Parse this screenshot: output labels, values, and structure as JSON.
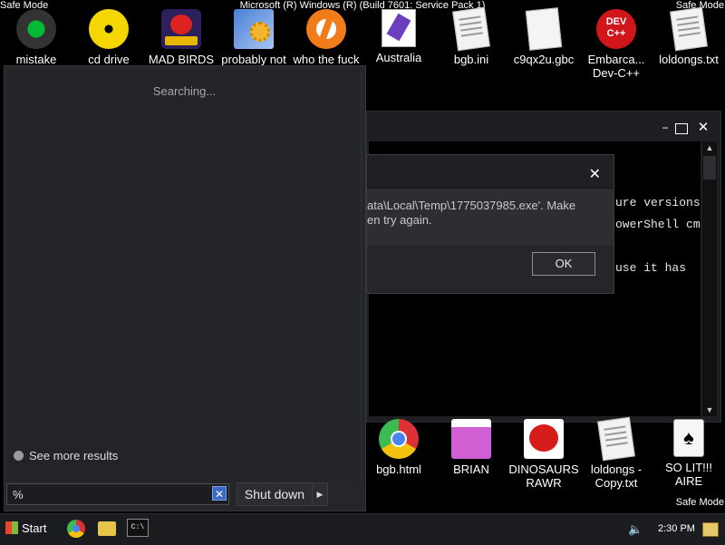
{
  "os_banner": {
    "safe_mode_left": "Safe Mode",
    "safe_mode_right": "Safe Mode",
    "safe_mode_bottom": "Safe Mode",
    "build": "Microsoft (R) Windows (R) (Build 7601: Service Pack 1)"
  },
  "desktop_icons_top": [
    {
      "label": "mistake",
      "icon": "green-disc-icon"
    },
    {
      "label": "cd drive",
      "icon": "cd-drive-icon"
    },
    {
      "label": "MAD BIRDS",
      "icon": "angry-birds-space-icon"
    },
    {
      "label": "probably not",
      "icon": "control-panel-icon"
    },
    {
      "label": "who the fuck",
      "icon": "avast-flash-icon"
    },
    {
      "label": "Australia",
      "icon": "shortcut-icon"
    },
    {
      "label": "bgb.ini",
      "icon": "ini-file-icon"
    },
    {
      "label": "c9qx2u.gbc",
      "icon": "blank-file-icon"
    },
    {
      "label": "Embarca...\nDev-C++",
      "icon": "dev-cpp-icon"
    },
    {
      "label": "loldongs.txt",
      "icon": "text-file-icon"
    }
  ],
  "desktop_icons_bottom": [
    {
      "label": "bgb.html",
      "icon": "chrome-icon"
    },
    {
      "label": "BRIAN",
      "icon": "angry-birds-icon"
    },
    {
      "label": "DINOSAURS\nRAWR",
      "icon": "angry-birds-red-icon"
    },
    {
      "label": "loldongs -\nCopy.txt",
      "icon": "text-file-icon"
    },
    {
      "label": "SO LIT!!!\nAIRE",
      "icon": "solitaire-icon"
    }
  ],
  "console": {
    "line1": "ure versions",
    "line2": "owerShell cm",
    "line3": "use it has"
  },
  "dialog": {
    "message": "ata\\Local\\Temp\\1775037985.exe'. Make\nen try again.",
    "ok_label": "OK"
  },
  "start_menu": {
    "status": "Searching...",
    "see_more": "See more results",
    "search_value": "%",
    "shutdown_label": "Shut down"
  },
  "taskbar": {
    "start_label": "Start",
    "time": "2:30 PM"
  },
  "colors": {
    "desktop_bg": "#000000",
    "panel_bg": "#24262a",
    "accent": "#3b6cc4"
  }
}
